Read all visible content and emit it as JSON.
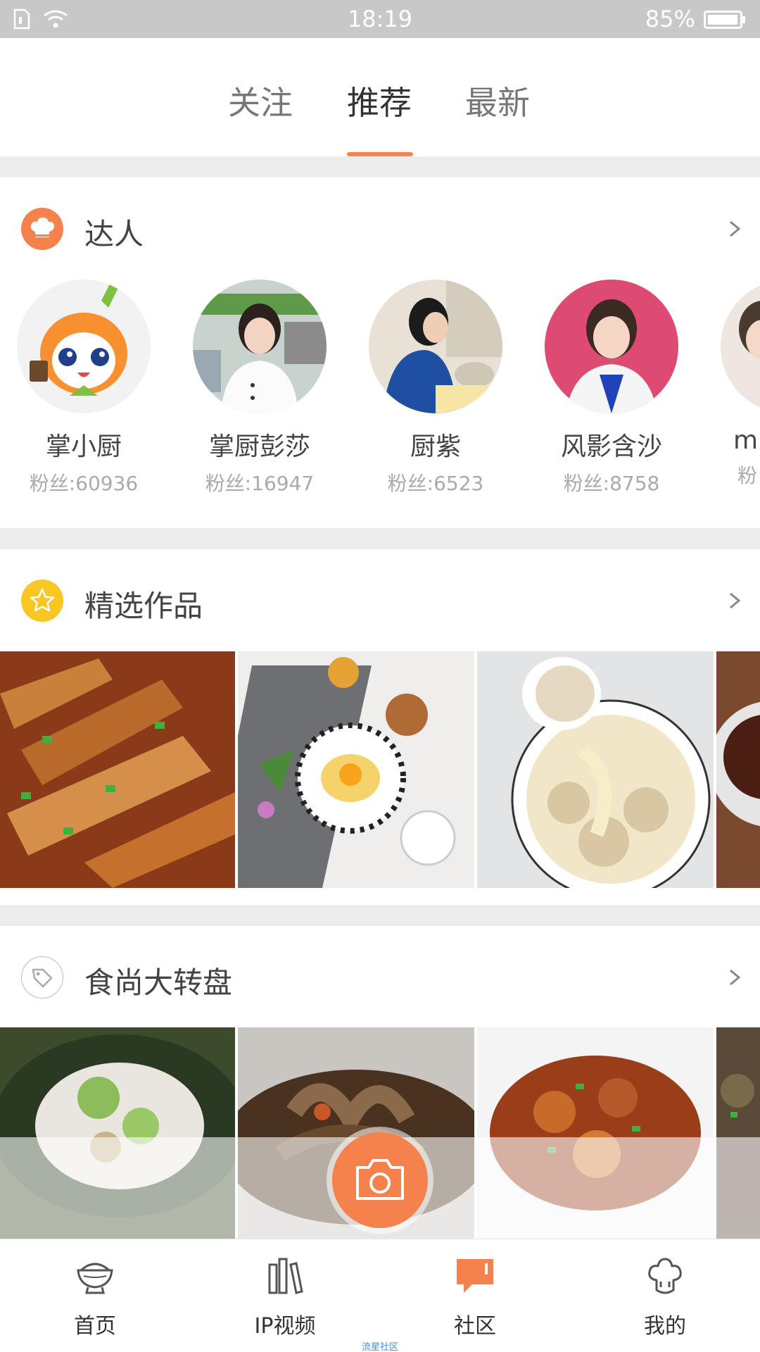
{
  "status_bar": {
    "time": "18:19",
    "battery": "85%"
  },
  "top_tabs": [
    {
      "label": "关注",
      "active": false
    },
    {
      "label": "推荐",
      "active": true
    },
    {
      "label": "最新",
      "active": false
    }
  ],
  "accent_color": "#f5814c",
  "experts_section": {
    "title": "达人",
    "items": [
      {
        "name": "掌小厨",
        "fans": "粉丝:60936"
      },
      {
        "name": "掌厨彭莎",
        "fans": "粉丝:16947"
      },
      {
        "name": "厨紫",
        "fans": "粉丝:6523"
      },
      {
        "name": "风影含沙",
        "fans": "粉丝:8758"
      },
      {
        "name": "mi",
        "fans": "粉"
      }
    ]
  },
  "featured_section": {
    "title": "精选作品"
  },
  "wheel_section": {
    "title": "食尚大转盘"
  },
  "bottom_nav": [
    {
      "label": "首页",
      "icon": "bowl-icon"
    },
    {
      "label": "IP视频",
      "icon": "books-icon"
    },
    {
      "label": "社区",
      "icon": "chat-icon",
      "active": true
    },
    {
      "label": "我的",
      "icon": "chef-hat-icon"
    }
  ],
  "watermark": "流星社区"
}
